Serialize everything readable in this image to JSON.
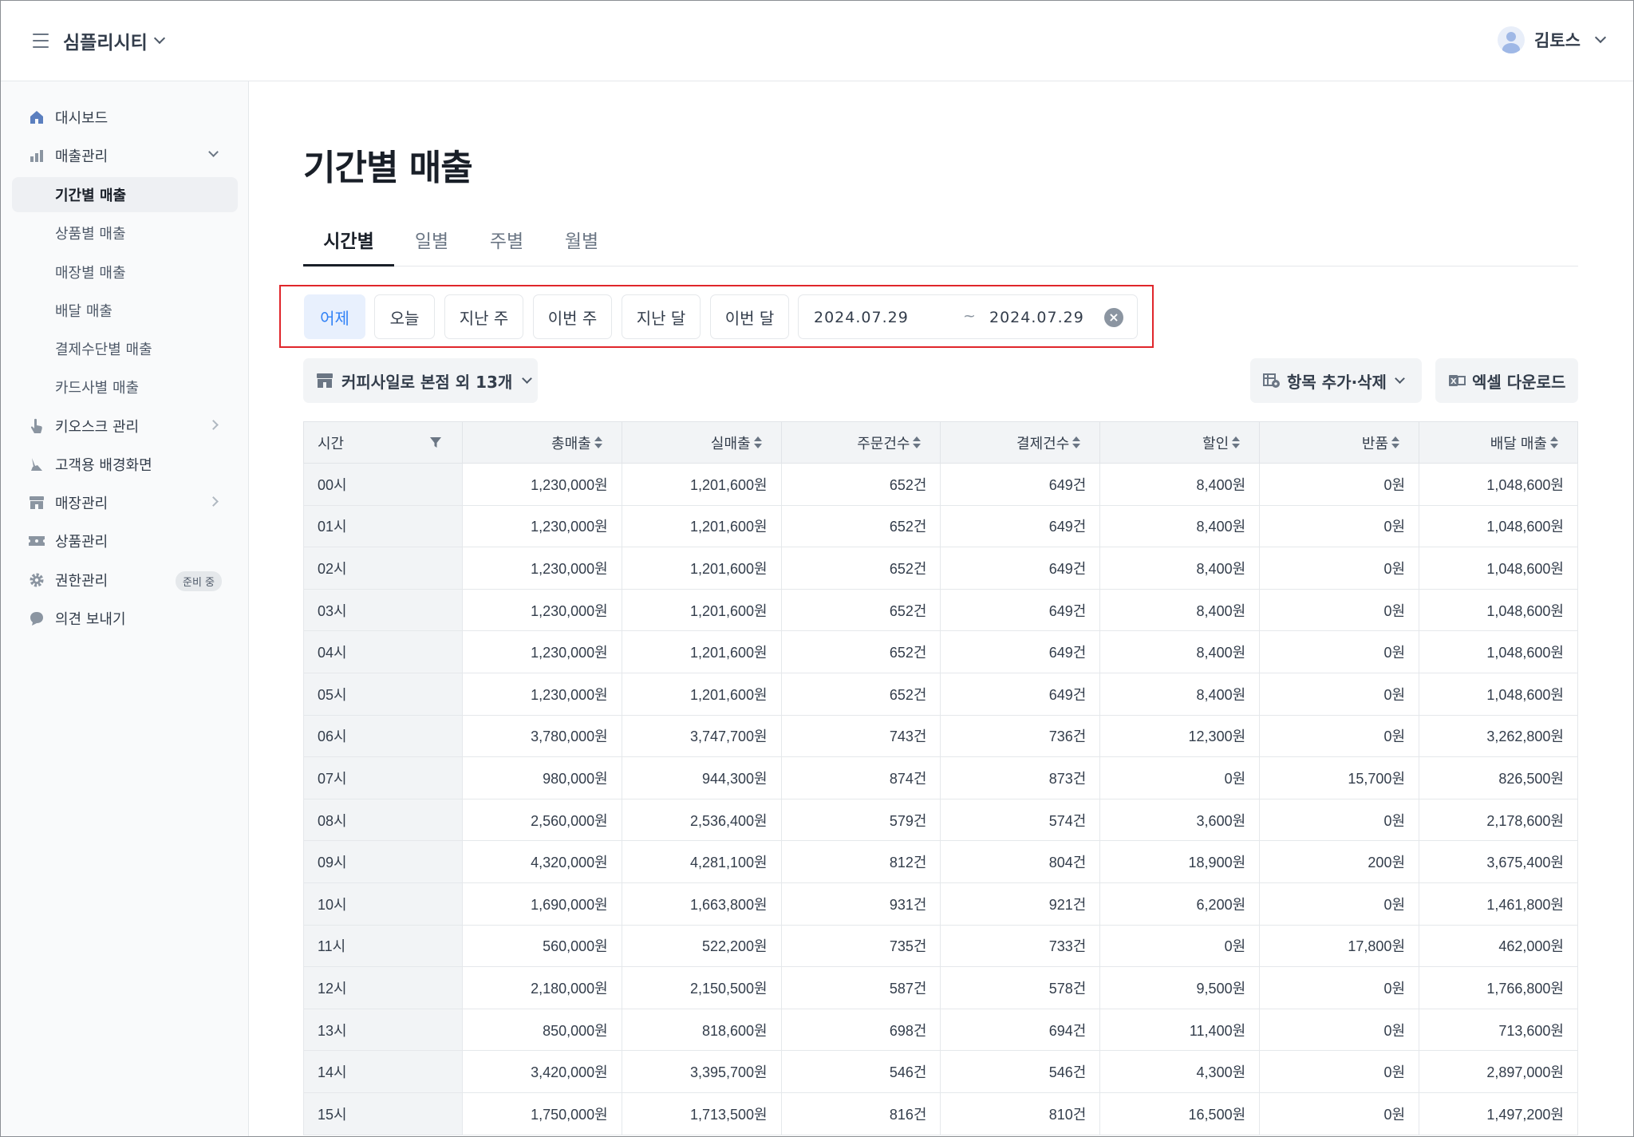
{
  "header": {
    "app_title": "심플리시티",
    "user_name": "김토스"
  },
  "sidebar": {
    "items": [
      {
        "label": "대시보드",
        "icon": "home-icon"
      },
      {
        "label": "매출관리",
        "icon": "bar-chart-icon"
      },
      {
        "label": "기간별 매출"
      },
      {
        "label": "상품별 매출"
      },
      {
        "label": "매장별 매출"
      },
      {
        "label": "배달 매출"
      },
      {
        "label": "결제수단별 매출"
      },
      {
        "label": "카드사별 매출"
      },
      {
        "label": "키오스크 관리",
        "icon": "pointer-hand-icon"
      },
      {
        "label": "고객용 배경화면",
        "icon": "brush-icon"
      },
      {
        "label": "매장관리",
        "icon": "store-icon"
      },
      {
        "label": "상품관리",
        "icon": "ticket-icon"
      },
      {
        "label": "권한관리",
        "icon": "gear-icon",
        "badge": "준비 중"
      },
      {
        "label": "의견 보내기",
        "icon": "speech-bubble-icon"
      }
    ]
  },
  "main": {
    "title": "기간별 매출",
    "tabs": [
      "시간별",
      "일별",
      "주별",
      "월별"
    ],
    "active_tab": "시간별",
    "quick_filters": [
      "어제",
      "오늘",
      "지난 주",
      "이번 주",
      "지난 달",
      "이번 달"
    ],
    "active_quick_filter": "어제",
    "date_from": "2024.07.29",
    "date_sep": "~",
    "date_to": "2024.07.29",
    "store_select": "커피사일로 본점 외 13개",
    "columns_button": "항목 추가·삭제",
    "excel_button": "엑셀 다운로드",
    "colors": {
      "accent": "#3182f6",
      "highlight_border": "#e0262b"
    }
  },
  "table": {
    "headers": [
      "시간",
      "총매출",
      "실매출",
      "주문건수",
      "결제건수",
      "할인",
      "반품",
      "배달 매출"
    ],
    "rows": [
      [
        "00시",
        "1,230,000원",
        "1,201,600원",
        "652건",
        "649건",
        "8,400원",
        "0원",
        "1,048,600원"
      ],
      [
        "01시",
        "1,230,000원",
        "1,201,600원",
        "652건",
        "649건",
        "8,400원",
        "0원",
        "1,048,600원"
      ],
      [
        "02시",
        "1,230,000원",
        "1,201,600원",
        "652건",
        "649건",
        "8,400원",
        "0원",
        "1,048,600원"
      ],
      [
        "03시",
        "1,230,000원",
        "1,201,600원",
        "652건",
        "649건",
        "8,400원",
        "0원",
        "1,048,600원"
      ],
      [
        "04시",
        "1,230,000원",
        "1,201,600원",
        "652건",
        "649건",
        "8,400원",
        "0원",
        "1,048,600원"
      ],
      [
        "05시",
        "1,230,000원",
        "1,201,600원",
        "652건",
        "649건",
        "8,400원",
        "0원",
        "1,048,600원"
      ],
      [
        "06시",
        "3,780,000원",
        "3,747,700원",
        "743건",
        "736건",
        "12,300원",
        "0원",
        "3,262,800원"
      ],
      [
        "07시",
        "980,000원",
        "944,300원",
        "874건",
        "873건",
        "0원",
        "15,700원",
        "826,500원"
      ],
      [
        "08시",
        "2,560,000원",
        "2,536,400원",
        "579건",
        "574건",
        "3,600원",
        "0원",
        "2,178,600원"
      ],
      [
        "09시",
        "4,320,000원",
        "4,281,100원",
        "812건",
        "804건",
        "18,900원",
        "200원",
        "3,675,400원"
      ],
      [
        "10시",
        "1,690,000원",
        "1,663,800원",
        "931건",
        "921건",
        "6,200원",
        "0원",
        "1,461,800원"
      ],
      [
        "11시",
        "560,000원",
        "522,200원",
        "735건",
        "733건",
        "0원",
        "17,800원",
        "462,000원"
      ],
      [
        "12시",
        "2,180,000원",
        "2,150,500원",
        "587건",
        "578건",
        "9,500원",
        "0원",
        "1,766,800원"
      ],
      [
        "13시",
        "850,000원",
        "818,600원",
        "698건",
        "694건",
        "11,400원",
        "0원",
        "713,600원"
      ],
      [
        "14시",
        "3,420,000원",
        "3,395,700원",
        "546건",
        "546건",
        "4,300원",
        "0원",
        "2,897,000원"
      ],
      [
        "15시",
        "1,750,000원",
        "1,713,500원",
        "816건",
        "810건",
        "16,500원",
        "0원",
        "1,497,200원"
      ]
    ]
  }
}
